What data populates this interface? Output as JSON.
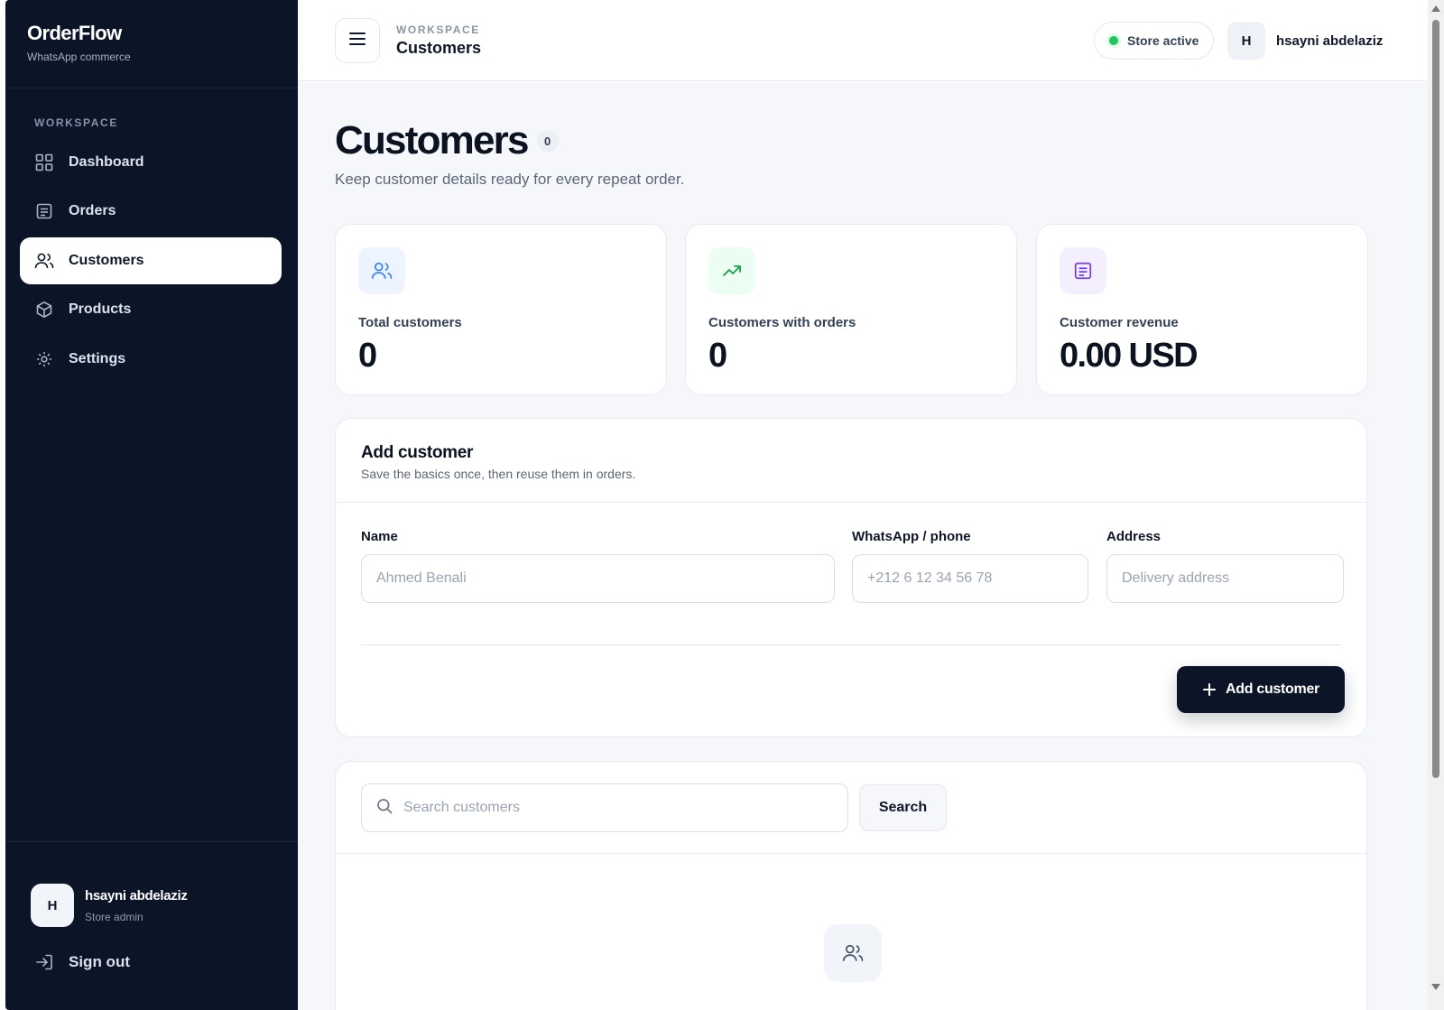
{
  "brand": {
    "title": "OrderFlow",
    "subtitle": "WhatsApp commerce"
  },
  "sidebar": {
    "section_label": "WORKSPACE",
    "items": [
      {
        "label": "Dashboard",
        "icon": "grid-icon",
        "active": false
      },
      {
        "label": "Orders",
        "icon": "receipt-icon",
        "active": false
      },
      {
        "label": "Customers",
        "icon": "users-icon",
        "active": true
      },
      {
        "label": "Products",
        "icon": "box-icon",
        "active": false
      },
      {
        "label": "Settings",
        "icon": "gear-icon",
        "active": false
      }
    ],
    "user": {
      "initial": "H",
      "name": "hsayni abdelaziz",
      "role": "Store admin"
    },
    "sign_out": "Sign out"
  },
  "topbar": {
    "breadcrumb_section": "WORKSPACE",
    "breadcrumb_title": "Customers",
    "status": "Store active",
    "user_initial": "H",
    "user_name": "hsayni abdelaziz"
  },
  "page": {
    "title": "Customers",
    "count": "0",
    "subtitle": "Keep customer details ready for every repeat order."
  },
  "stats": [
    {
      "label": "Total customers",
      "value": "0",
      "icon": "users-icon",
      "icon_color": "#3b82f6",
      "icon_bg": "#eef4ff"
    },
    {
      "label": "Customers with orders",
      "value": "0",
      "icon": "trending-up-icon",
      "icon_color": "#16a34a",
      "icon_bg": "#ecfdf3"
    },
    {
      "label": "Customer revenue",
      "value": "0.00 USD",
      "icon": "receipt-icon",
      "icon_color": "#7c3aed",
      "icon_bg": "#f4efff"
    }
  ],
  "add_customer": {
    "title": "Add customer",
    "subtitle": "Save the basics once, then reuse them in orders.",
    "fields": {
      "name": {
        "label": "Name",
        "placeholder": "Ahmed Benali",
        "value": ""
      },
      "phone": {
        "label": "WhatsApp / phone",
        "placeholder": "+212 6 12 34 56 78",
        "value": ""
      },
      "address": {
        "label": "Address",
        "placeholder": "Delivery address",
        "value": ""
      }
    },
    "button": "Add customer"
  },
  "list": {
    "search_placeholder": "Search customers",
    "search_value": "",
    "search_button": "Search"
  },
  "colors": {
    "sidebar_bg": "#0b1527",
    "accent": "#0b1527",
    "status": "#22c55e"
  }
}
